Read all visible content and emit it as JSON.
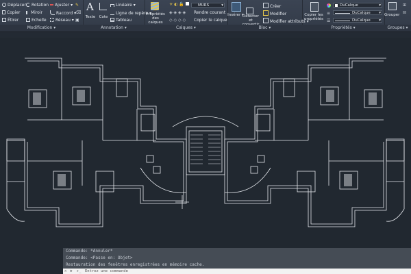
{
  "ribbon": {
    "modification": {
      "title": "Modification",
      "items": [
        "Déplacer",
        "Rotation",
        "Ajuster",
        "Copier",
        "Miroir",
        "Raccord",
        "Étirer",
        "Echelle",
        "Réseau"
      ]
    },
    "annotation": {
      "title": "Annotation",
      "texte": "Texte",
      "cote": "Cote",
      "lineaire": "Linéaire",
      "ligne_repere": "Ligne de repère",
      "tableau": "Tableau"
    },
    "calques": {
      "title": "Calques",
      "proprietes_calques": "Propriétés des calques",
      "layer_name": "MURS",
      "rendre_courant": "Rendre courant",
      "copier_calque": "Copier le calque"
    },
    "bloc": {
      "title": "Bloc",
      "inserer": "Insérer",
      "creer": "Créer",
      "modifier": "Modifier",
      "modifier_attributs": "Modifier attributs",
      "detecter": "Détecter et convertir"
    },
    "proprietes": {
      "title": "Propriétés",
      "copier_proprietes": "Copier les propriétés",
      "couleur": "DuCalque",
      "type_ligne": "DuCalque",
      "epaisseur": "DuCalque"
    },
    "groupes": {
      "title": "Groupes",
      "grouper": "Grouper"
    }
  },
  "command": {
    "history": [
      "Commande: *Annuler*",
      "Commande: <Passe en: Objet>",
      "Restauration des fenêtres enregistrées en mémoire cache."
    ],
    "placeholder": "Entrez une commande"
  },
  "colors": {
    "ribbon": "#3b4453",
    "canvas": "#212830",
    "lines": "#e6e9ee",
    "command_history": "#4b525c"
  }
}
